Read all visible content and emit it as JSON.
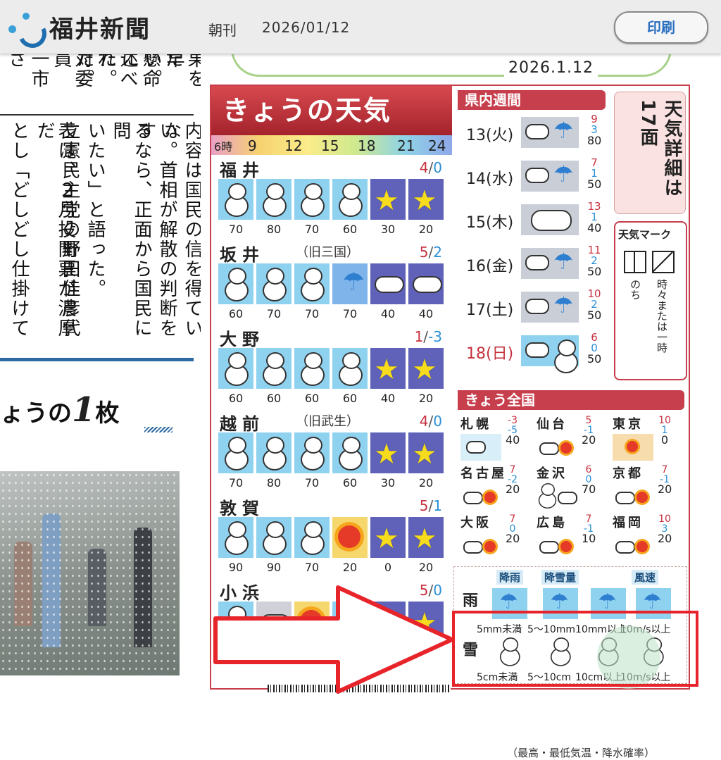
{
  "header": {
    "brand": "福井新聞",
    "edition": "朝刊",
    "date": "2026/01/12",
    "print_label": "印刷"
  },
  "left": {
    "col_top": [
      "ざ",
      "一市",
      "対委員",
      "れた。",
      "述べた。",
      "懸命に",
      "たい。",
      "果を早"
    ],
    "col_mid": [
      "とし「どしどし仕掛けて",
      "表は、２月投開票が濃厚だ",
      "立憲民主党の野田佳彦代",
      "いたい」と語った。",
      "るなら、正面から国民に問",
      "い。首相が解散の判断をす",
      "内容は国民の信を得ていな"
    ],
    "kyouno_pre": "ょうの",
    "kyouno_num": "1",
    "kyouno_post": "枚"
  },
  "page_date": "2026.1.12",
  "weather": {
    "title": "きょうの天気",
    "hours": [
      "6時",
      "9",
      "12",
      "15",
      "18",
      "21",
      "24"
    ],
    "cities": [
      {
        "name": "福井",
        "old": "",
        "hi": "4",
        "lo": "0",
        "icons": [
          "snow",
          "snow",
          "snow",
          "snow",
          "night",
          "night"
        ],
        "pcts": [
          "70",
          "80",
          "70",
          "60",
          "30",
          "20"
        ]
      },
      {
        "name": "坂井",
        "old": "（旧三国）",
        "hi": "5",
        "lo": "2",
        "icons": [
          "snow",
          "snow",
          "snow",
          "rain",
          "cloudy-night",
          "cloudy-night"
        ],
        "pcts": [
          "60",
          "70",
          "70",
          "70",
          "40",
          "40"
        ]
      },
      {
        "name": "大野",
        "old": "",
        "hi": "1",
        "lo": "-3",
        "icons": [
          "snow",
          "snow",
          "snow",
          "snow",
          "night",
          "night"
        ],
        "pcts": [
          "60",
          "60",
          "60",
          "60",
          "40",
          "20"
        ]
      },
      {
        "name": "越前",
        "old": "（旧武生）",
        "hi": "4",
        "lo": "0",
        "icons": [
          "snow",
          "snow",
          "snow",
          "snow",
          "night",
          "night"
        ],
        "pcts": [
          "70",
          "80",
          "70",
          "60",
          "30",
          "20"
        ]
      },
      {
        "name": "敦賀",
        "old": "",
        "hi": "5",
        "lo": "1",
        "icons": [
          "snow",
          "snow",
          "snow",
          "sun",
          "night",
          "night"
        ],
        "pcts": [
          "90",
          "90",
          "70",
          "20",
          "0",
          "20"
        ]
      },
      {
        "name": "小浜",
        "old": "",
        "hi": "5",
        "lo": "0",
        "icons": [
          "snow",
          "cloudy",
          "sun",
          "snow",
          "night",
          "night"
        ],
        "pcts": [
          "",
          "",
          "",
          "",
          "",
          ""
        ]
      }
    ],
    "weekly_title": "県内週間",
    "weekly": [
      {
        "day": "13(火)",
        "hi": "9",
        "lo": "3",
        "p": "80",
        "kind": "rain"
      },
      {
        "day": "14(水)",
        "hi": "7",
        "lo": "1",
        "p": "50",
        "kind": "rain"
      },
      {
        "day": "15(木)",
        "hi": "13",
        "lo": "1",
        "p": "40",
        "kind": "cloud"
      },
      {
        "day": "16(金)",
        "hi": "11",
        "lo": "2",
        "p": "50",
        "kind": "rain"
      },
      {
        "day": "17(土)",
        "hi": "10",
        "lo": "2",
        "p": "50",
        "kind": "rain"
      },
      {
        "day": "18(日)",
        "hi": "6",
        "lo": "0",
        "p": "50",
        "kind": "snow"
      }
    ],
    "detail_note": "天気詳細は17面",
    "mark_title": "天気マーク",
    "mark_nochi": "のち",
    "mark_tokidoki": "時々または一時",
    "national_title": "きょう全国",
    "national": [
      {
        "name": "札幌",
        "hi": "-3",
        "lo": "-5",
        "p": "40"
      },
      {
        "name": "仙台",
        "hi": "5",
        "lo": "-1",
        "p": "20"
      },
      {
        "name": "東京",
        "hi": "10",
        "lo": "1",
        "p": "0"
      },
      {
        "name": "名古屋",
        "hi": "7",
        "lo": "-2",
        "p": "20"
      },
      {
        "name": "金沢",
        "hi": "6",
        "lo": "0",
        "p": "70"
      },
      {
        "name": "京都",
        "hi": "7",
        "lo": "-1",
        "p": "20"
      },
      {
        "name": "大阪",
        "hi": "7",
        "lo": "0",
        "p": "20"
      },
      {
        "name": "広島",
        "hi": "7",
        "lo": "-1",
        "p": "10"
      },
      {
        "name": "福岡",
        "hi": "10",
        "lo": "3",
        "p": "20"
      }
    ],
    "legend": {
      "h_rain": "降雨",
      "h_snow": "降雪量",
      "h_wind": "風速",
      "rain_label": "雨",
      "snow_label": "雪",
      "rain_caps": [
        "5mm未満",
        "5～10mm",
        "10mm以上",
        "10m/s以上"
      ],
      "snow_caps": [
        "5cm未満",
        "5～10cm",
        "10cm以上",
        "10m/s以上"
      ]
    },
    "bottom_note": "（最高・最低気温・降水確率）"
  },
  "colors": {
    "accent": "#c73e4c",
    "highlight": "#e8242b",
    "print_text": "#2a6fc0"
  }
}
